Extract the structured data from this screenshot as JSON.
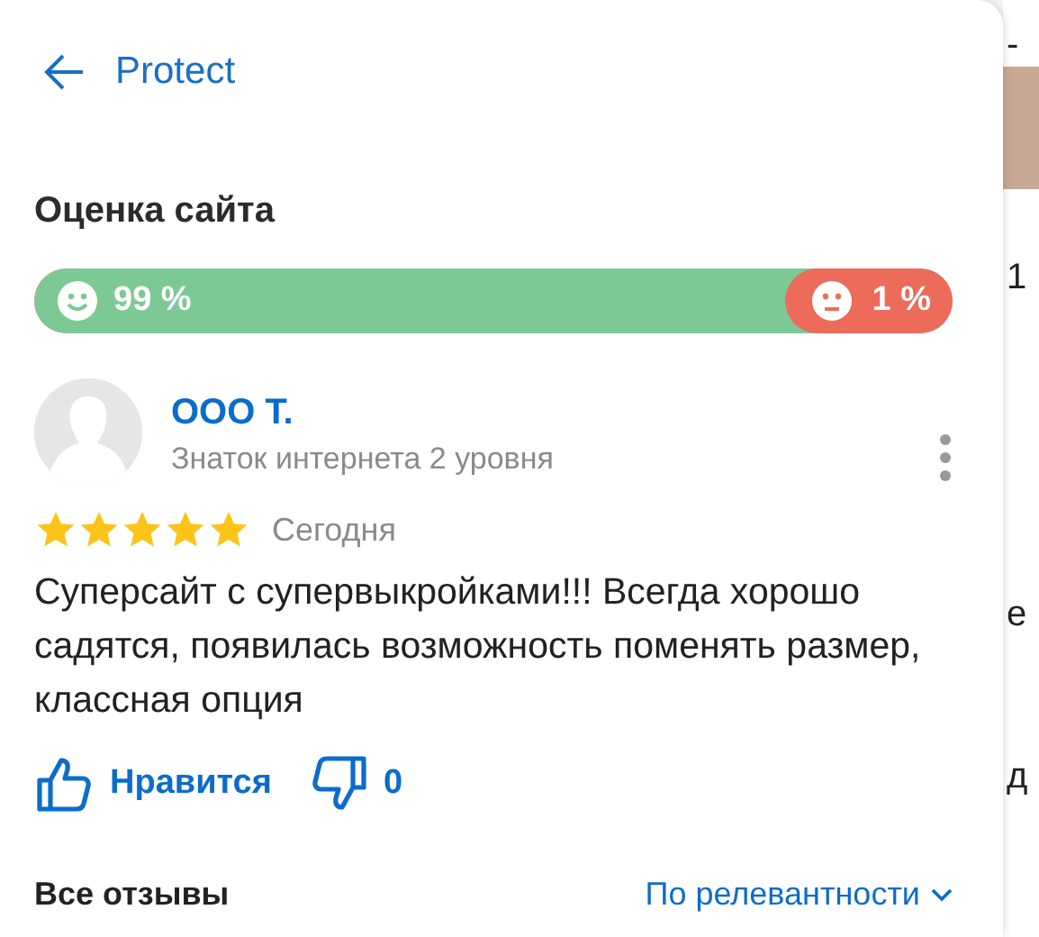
{
  "header": {
    "back_label": "Protect"
  },
  "rating": {
    "title": "Оценка сайта",
    "positive": {
      "label": "99 %",
      "level": 0.99
    },
    "negative": {
      "label": "1 %"
    }
  },
  "review": {
    "author": "ООО Т.",
    "author_level": "Знаток интернета 2 уровня",
    "stars": 5,
    "date": "Сегодня",
    "text": "Суперсайт с супервыкройками!!! Всегда хорошо садятся, появилась возможность поменять размер, классная опция",
    "like_label": "Нравится",
    "dislike_count": "0"
  },
  "footer": {
    "all_reviews": "Все отзывы",
    "sort": "По релевантности"
  },
  "background_page": {
    "fragments": [
      "-",
      "1",
      "е",
      "д"
    ]
  }
}
